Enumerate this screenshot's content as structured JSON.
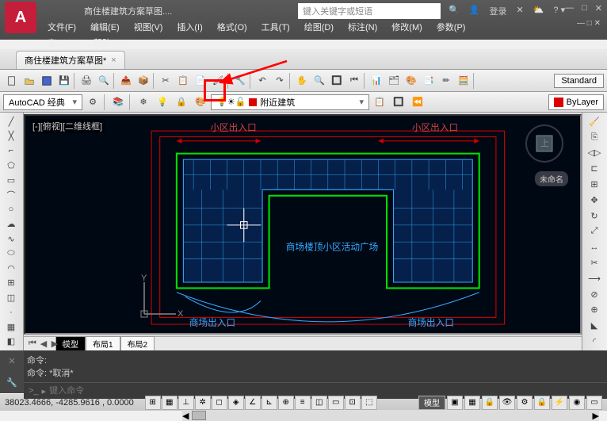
{
  "title": "商住楼建筑方案草图....",
  "search_placeholder": "键入关键字或短语",
  "login": "登录",
  "menus": [
    "文件(F)",
    "编辑(E)",
    "视图(V)",
    "插入(I)",
    "格式(O)",
    "工具(T)",
    "绘图(D)",
    "标注(N)",
    "修改(M)",
    "参数(P)"
  ],
  "menus2": [
    "窗口(W)",
    "帮助(H)"
  ],
  "tab_name": "商住楼建筑方案草图*",
  "workspace_combo": "AutoCAD 经典",
  "layer_label": "附近建筑",
  "bylayer": "ByLayer",
  "standard": "Standard",
  "viewport_label": "[-][俯视][二维线框]",
  "unnamed": "未命名",
  "layout_tabs": {
    "model": "模型",
    "l1": "布局1",
    "l2": "布局2"
  },
  "cmd_lines": [
    "命令:",
    "命令: *取消*"
  ],
  "cmd_prompt_prefix": ">_",
  "cmd_placeholder": "键入命令",
  "coords": "38023.4666, -4285.9616 , 0.0000",
  "status_model": "模型",
  "drawing_labels": {
    "top_left": "小区出入口",
    "top_right": "小区出入口",
    "center": "商场楼顶小区活动广场",
    "bottom_left": "商场出入口",
    "bottom_right": "商场出入口"
  },
  "icons": {
    "new": "new-icon",
    "open": "open-icon",
    "save": "save-icon",
    "print": "print-icon",
    "cut": "cut-icon",
    "copy": "copy-icon",
    "paste": "paste-icon",
    "undo": "undo-icon",
    "redo": "redo-icon"
  }
}
